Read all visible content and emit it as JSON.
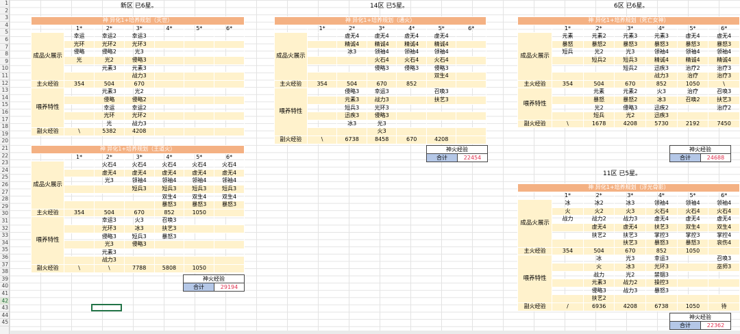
{
  "zones": [
    {
      "id": "xinqu",
      "title": "新区 已6星。",
      "tables": [
        {
          "header": "神 异化1+培养规划（灭世）",
          "stars": [
            "1*",
            "2*",
            "3*",
            "4*",
            "5*",
            "6*"
          ],
          "zhan_label": "成品火展示",
          "zhan": [
            [
              "幸运",
              "幸运2",
              "幸运3",
              "",
              "",
              ""
            ],
            [
              "光环",
              "光环2",
              "光环3",
              "",
              "",
              ""
            ],
            [
              "侵略",
              "侵略2",
              "光3",
              "",
              "",
              ""
            ],
            [
              "光",
              "光2",
              "侵略3",
              "",
              "",
              ""
            ],
            [
              "",
              "元素3",
              "元素3",
              "",
              "",
              ""
            ],
            [
              "",
              "",
              "战力3",
              "",
              "",
              ""
            ]
          ],
          "main_label": "主火经验",
          "main": [
            "354",
            "504",
            "670",
            "",
            "",
            ""
          ],
          "wei_label": "喂养特性",
          "wei": [
            [
              "",
              "元素3",
              "光2",
              "",
              "",
              ""
            ],
            [
              "",
              "侵略",
              "侵略2",
              "",
              "",
              ""
            ],
            [
              "",
              "幸运",
              "幸运2",
              "",
              "",
              ""
            ],
            [
              "",
              "光环",
              "光环2",
              "",
              "",
              ""
            ],
            [
              "",
              "光",
              "战力3",
              "",
              "",
              ""
            ]
          ],
          "sub_label": "副火经验",
          "sub": [
            "\\",
            "5382",
            "4208",
            "",
            "",
            ""
          ]
        },
        {
          "header": "神 异化1+培养规划（王道火）",
          "stars": [
            "1*",
            "2*",
            "3*",
            "4*",
            "5*",
            "6*"
          ],
          "zhan_label": "成品火展示",
          "zhan": [
            [
              "",
              "火石4",
              "火石4",
              "火石4",
              "火石4",
              "火石4"
            ],
            [
              "",
              "虚无4",
              "虚无4",
              "虚无4",
              "虚无4",
              "虚无4"
            ],
            [
              "",
              "光3",
              "领袖4",
              "领袖4",
              "领袖4",
              "领袖4"
            ],
            [
              "",
              "",
              "短兵3",
              "短兵3",
              "短兵3",
              "短兵3"
            ],
            [
              "",
              "",
              "",
              "双生4",
              "双生4",
              "双生4"
            ],
            [
              "",
              "",
              "",
              "暴怒3",
              "暴怒3",
              "暴怒3"
            ]
          ],
          "main_label": "主火经验",
          "main": [
            "354",
            "504",
            "670",
            "852",
            "1050",
            ""
          ],
          "wei_label": "喂养特性",
          "wei": [
            [
              "",
              "幸运3",
              "火3",
              "召唤3",
              "",
              ""
            ],
            [
              "",
              "光环3",
              "冰3",
              "扶艺3",
              "",
              ""
            ],
            [
              "",
              "侵略3",
              "短兵3",
              "暴怒3",
              "",
              ""
            ],
            [
              "",
              "光3",
              "侵略3",
              "",
              "",
              ""
            ],
            [
              "",
              "元素3",
              "",
              "",
              "",
              ""
            ],
            [
              "",
              "战力3",
              "",
              "",
              "",
              ""
            ]
          ],
          "sub_label": "副火经验",
          "sub": [
            "\\",
            "\\",
            "7788",
            "5808",
            "1050",
            ""
          ]
        }
      ],
      "summary": {
        "title": "神火经验",
        "label": "合计",
        "value": "29194"
      }
    },
    {
      "id": "14qu",
      "title": "14区 已5星。",
      "tables": [
        {
          "header": "神 异化1+培养规划（通火）",
          "stars": [
            "1*",
            "2*",
            "3*",
            "4*",
            "5*",
            "6*"
          ],
          "zhan_label": "成品火展示",
          "zhan": [
            [
              "",
              "虚无4",
              "虚无4",
              "虚无4",
              "虚无4",
              ""
            ],
            [
              "",
              "精诚4",
              "精诚4",
              "精诚4",
              "精诚4",
              ""
            ],
            [
              "",
              "冰3",
              "领袖4",
              "领袖4",
              "领袖4",
              ""
            ],
            [
              "",
              "",
              "火石4",
              "火石4",
              "火石4",
              ""
            ],
            [
              "",
              "",
              "侵略3",
              "侵略3",
              "侵略3",
              ""
            ],
            [
              "",
              "",
              "",
              "",
              "双生4",
              ""
            ]
          ],
          "main_label": "主火经验",
          "main": [
            "354",
            "504",
            "670",
            "852",
            "",
            ""
          ],
          "wei_label": "喂养特性",
          "wei": [
            [
              "",
              "侵略3",
              "幸运3",
              "",
              "召唤3",
              ""
            ],
            [
              "",
              "元素3",
              "战力3",
              "",
              "扶艺3",
              ""
            ],
            [
              "",
              "短兵3",
              "光环3",
              "",
              "",
              ""
            ],
            [
              "",
              "迅疾3",
              "侵略3",
              "",
              "",
              ""
            ],
            [
              "",
              "冰3",
              "光3",
              "",
              "",
              ""
            ],
            [
              "",
              "",
              "火3",
              "",
              "",
              ""
            ]
          ],
          "sub_label": "副火经验",
          "sub": [
            "\\",
            "6738",
            "8458",
            "670",
            "4208",
            ""
          ]
        }
      ],
      "summary": {
        "title": "神火经验",
        "label": "合计",
        "value": "22454"
      }
    },
    {
      "id": "6qu",
      "title": "6区 已6星。",
      "tables": [
        {
          "header": "神 异化1+培养规划（死亡女神）",
          "stars": [
            "1*",
            "2*",
            "3*",
            "4*",
            "5*",
            "6*"
          ],
          "zhan_label": "成品火展示",
          "zhan": [
            [
              "元素",
              "元素2",
              "元素3",
              "元素3",
              "虚无4",
              "虚无4"
            ],
            [
              "暴怒",
              "暴怒2",
              "暴怒3",
              "暴怒3",
              "暴怒3",
              "暴怒3"
            ],
            [
              "短兵",
              "光2",
              "光3",
              "领袖4",
              "领袖4",
              "领袖4"
            ],
            [
              "",
              "短兵2",
              "短兵3",
              "精诚4",
              "精诚4",
              "精诚4"
            ],
            [
              "",
              "",
              "短兵2",
              "迅疾3",
              "治疗2",
              "治疗3"
            ],
            [
              "",
              "",
              "",
              "战力3",
              "治疗",
              "治疗3"
            ]
          ],
          "main_label": "主火经验",
          "main": [
            "354",
            "504",
            "670",
            "852",
            "1050",
            "\\"
          ],
          "wei_label": "喂养特性",
          "wei": [
            [
              "",
              "元素",
              "元素2",
              "火3",
              "治疗",
              "召唤3"
            ],
            [
              "",
              "暴怒",
              "暴怒2",
              "冰3",
              "召唤2",
              "扶艺3"
            ],
            [
              "",
              "光2",
              "侵略3",
              "迅疾2",
              "",
              "治疗2"
            ],
            [
              "",
              "短兵",
              "光2",
              "迅疾3",
              "",
              ""
            ]
          ],
          "sub_label": "副火经验",
          "sub": [
            "\\",
            "1678",
            "4208",
            "5730",
            "2192",
            "7450"
          ]
        }
      ],
      "summary": {
        "title": "神火经验",
        "label": "合计",
        "value": "24688"
      }
    },
    {
      "id": "11qu",
      "title": "11区 已5星。",
      "tables": [
        {
          "header": "神 异化1+培养规划（浮光骨影）",
          "stars": [
            "1*",
            "2*",
            "3*",
            "4*",
            "5*",
            "6*"
          ],
          "zhan_label": "成品火展示",
          "zhan": [
            [
              "冰",
              "冰2",
              "冰3",
              "领袖4",
              "领袖4",
              "领袖4"
            ],
            [
              "火",
              "火2",
              "火3",
              "火石4",
              "火石4",
              "火石4"
            ],
            [
              "战力",
              "战力2",
              "战力3",
              "虚无4",
              "虚无4",
              "虚无4"
            ],
            [
              "",
              "虚无4",
              "虚无4",
              "扶艺3",
              "双生4",
              "双生4"
            ],
            [
              "",
              "扶艺2",
              "扶艺3",
              "掌控3",
              "掌控3",
              "掌控4"
            ],
            [
              "",
              "",
              "扶艺3",
              "暴怒3",
              "暴怒3",
              "哀伤4"
            ]
          ],
          "main_label": "主火经验",
          "main": [
            "354",
            "504",
            "670",
            "852",
            "1050",
            ""
          ],
          "wei_label": "喂养特性",
          "wei": [
            [
              "",
              "冰",
              "光3",
              "幸运3",
              "",
              "召唤3"
            ],
            [
              "",
              "火",
              "冰3",
              "光环3",
              "",
              "巫师3"
            ],
            [
              "",
              "战力",
              "光2",
              "禁锢3",
              "",
              ""
            ],
            [
              "",
              "元素3",
              "战力2",
              "操控3",
              "",
              ""
            ],
            [
              "",
              "侵略3",
              "战力3",
              "暴怒3",
              "",
              ""
            ],
            [
              "",
              "扶艺2",
              "",
              "",
              "",
              ""
            ]
          ],
          "sub_label": "副火经验",
          "sub": [
            "/",
            "6936",
            "4208",
            "6738",
            "1050",
            "待"
          ]
        }
      ],
      "summary": {
        "title": "神火经验",
        "label": "合计",
        "value": "22362"
      }
    }
  ],
  "row_numbers": [
    "1",
    "2",
    "3",
    "4",
    "5",
    "6",
    "7",
    "8",
    "9",
    "10",
    "11",
    "12",
    "13",
    "14",
    "15",
    "16",
    "17",
    "18",
    "19",
    "20",
    "21",
    "22",
    "23",
    "24",
    "25",
    "26",
    "27",
    "28",
    "29",
    "30",
    "31",
    "32",
    "33",
    "34",
    "35",
    "36",
    "37",
    "38",
    "39",
    "40",
    "41",
    "42",
    "43",
    "44",
    "45"
  ],
  "selected_row": "42"
}
